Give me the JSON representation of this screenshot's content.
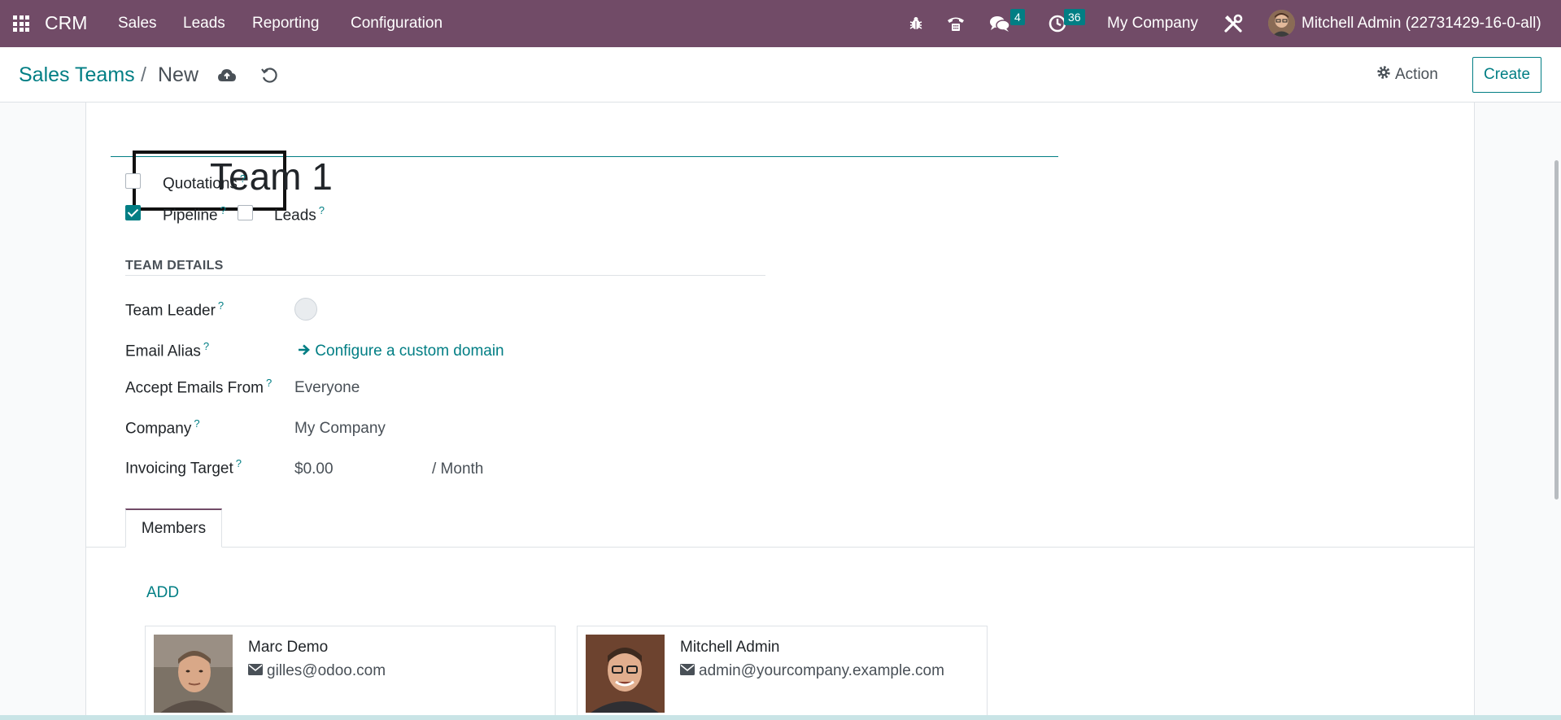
{
  "navbar": {
    "app_name": "CRM",
    "menu": [
      "Sales",
      "Leads",
      "Reporting",
      "Configuration"
    ],
    "messages_badge": "4",
    "activities_badge": "36",
    "company": "My Company",
    "user": "Mitchell Admin (22731429-16-0-all)",
    "bar_color": "#714b67"
  },
  "breadcrumb": {
    "parent": "Sales Teams",
    "separator": "/",
    "current": "New"
  },
  "actions": {
    "action_label": "Action",
    "create_label": "Create"
  },
  "form": {
    "name": "Team 1",
    "options": {
      "quotations": {
        "label": "Quotations",
        "checked": false
      },
      "pipeline": {
        "label": "Pipeline",
        "checked": true
      },
      "leads": {
        "label": "Leads",
        "checked": false
      }
    },
    "section_title": "TEAM DETAILS",
    "fields": {
      "team_leader_label": "Team Leader",
      "email_alias_label": "Email Alias",
      "email_alias_link": "Configure a custom domain",
      "accept_emails_label": "Accept Emails From",
      "accept_emails_value": "Everyone",
      "company_label": "Company",
      "company_value": "My Company",
      "invoicing_label": "Invoicing Target",
      "invoicing_value": "$0.00",
      "invoicing_period": "/ Month"
    },
    "help_mark": "?"
  },
  "tabs": {
    "members": "Members"
  },
  "members": {
    "add_label": "ADD",
    "cards": [
      {
        "name": "Marc Demo",
        "email": "gilles@odoo.com"
      },
      {
        "name": "Mitchell Admin",
        "email": "admin@yourcompany.example.com"
      }
    ]
  },
  "colors": {
    "accent": "#017e84",
    "brand": "#714b67"
  }
}
